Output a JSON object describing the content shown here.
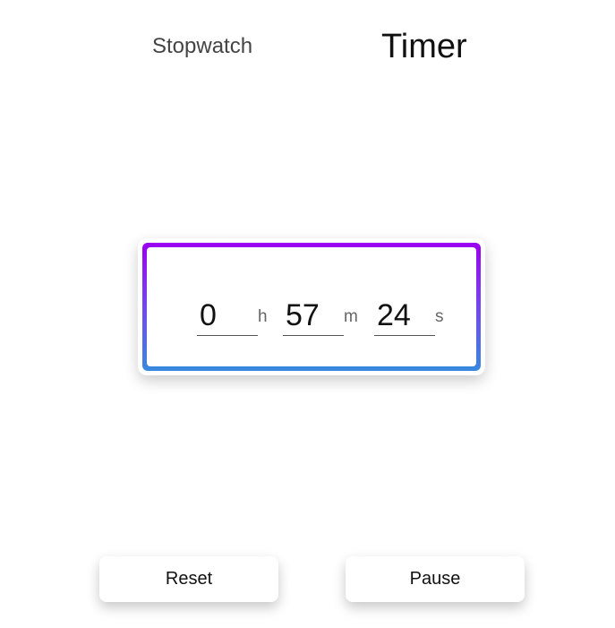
{
  "tabs": {
    "stopwatch_label": "Stopwatch",
    "timer_label": "Timer",
    "active": "Timer"
  },
  "timer": {
    "hours": "0",
    "minutes": "57",
    "seconds": "24",
    "hours_unit": "h",
    "minutes_unit": "m",
    "seconds_unit": "s"
  },
  "controls": {
    "reset_label": "Reset",
    "pause_label": "Pause"
  },
  "colors": {
    "gradient_top": "#9b00f0",
    "gradient_bottom": "#3789dd"
  }
}
